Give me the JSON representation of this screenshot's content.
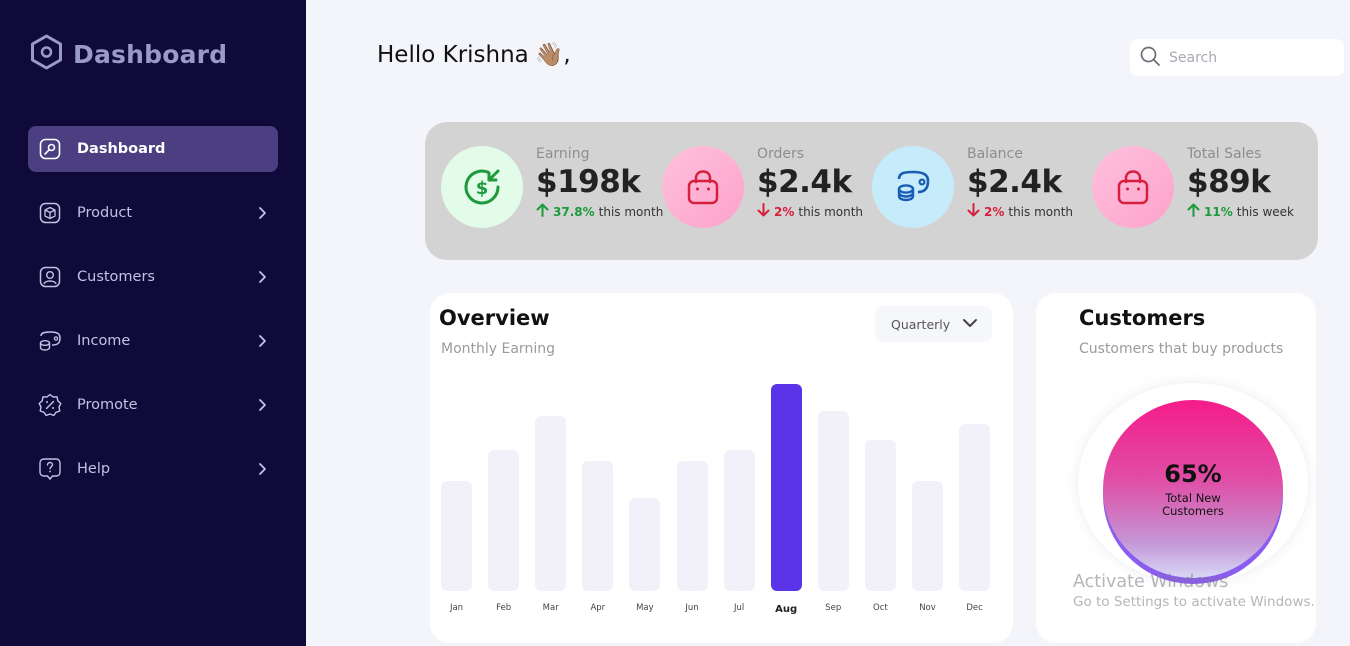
{
  "sidebar": {
    "brand": "Dashboard",
    "items": [
      {
        "label": "Dashboard"
      },
      {
        "label": "Product"
      },
      {
        "label": "Customers"
      },
      {
        "label": "Income"
      },
      {
        "label": "Promote"
      },
      {
        "label": "Help"
      }
    ]
  },
  "header": {
    "greeting": "Hello Krishna",
    "greeting_emoji": "👋🏽",
    "greeting_suffix": ",",
    "search_placeholder": "Search"
  },
  "stats": [
    {
      "label": "Earning",
      "value": "$198k",
      "change": "37.8%",
      "direction": "up",
      "period": "this month",
      "icon": "dollar-icon"
    },
    {
      "label": "Orders",
      "value": "$2.4k",
      "change": "2%",
      "direction": "down",
      "period": "this month",
      "icon": "bag-icon"
    },
    {
      "label": "Balance",
      "value": "$2.4k",
      "change": "2%",
      "direction": "down",
      "period": "this month",
      "icon": "wallet-icon"
    },
    {
      "label": "Total Sales",
      "value": "$89k",
      "change": "11%",
      "direction": "up",
      "period": "this week",
      "icon": "bag-icon"
    }
  ],
  "overview": {
    "title": "Overview",
    "subtitle": "Monthly Earning",
    "period_select": "Quarterly"
  },
  "chart_data": {
    "type": "bar",
    "categories": [
      "Jan",
      "Feb",
      "Mar",
      "Apr",
      "May",
      "Jun",
      "Jul",
      "Aug",
      "Sep",
      "Oct",
      "Nov",
      "Dec"
    ],
    "values": [
      110,
      141,
      175,
      130,
      93,
      130,
      141,
      207,
      180,
      151,
      110,
      167
    ],
    "highlight": "Aug",
    "colors": {
      "bar": "#f2f1fa",
      "highlight": "#5b33e8"
    }
  },
  "customers": {
    "title": "Customers",
    "subtitle": "Customers that buy products",
    "percent": "65%",
    "label": "Total New Customers"
  },
  "watermark": {
    "line1": "Activate Windows",
    "line2": "Go to Settings to activate Windows."
  },
  "colors": {
    "sidebar_bg": "#0f0a3a",
    "active_item": "#4b3f82",
    "accent": "#5b33e8",
    "up": "#1d9a3c",
    "down": "#d61f3c"
  }
}
